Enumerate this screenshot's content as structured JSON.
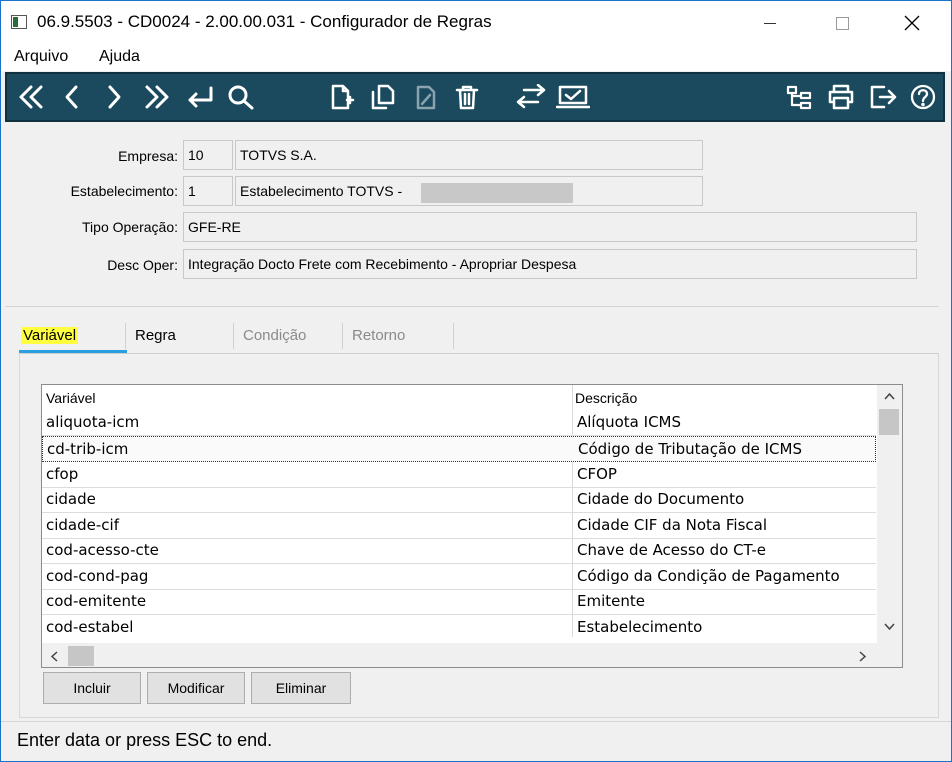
{
  "window": {
    "title": "06.9.5503 - CD0024 - 2.00.00.031 - Configurador de Regras",
    "minimize": "–",
    "maximize": "☐",
    "close": "✕"
  },
  "menu": {
    "items": [
      {
        "label": "Arquivo"
      },
      {
        "label": "Ajuda"
      }
    ]
  },
  "toolbar": {
    "buttons": [
      "first-icon",
      "previous-icon",
      "next-icon",
      "last-icon",
      "goto-icon",
      "search-icon",
      "new-icon",
      "copy-icon",
      "edit-icon",
      "delete-icon",
      "swap-icon",
      "confirm-icon",
      "tree-icon",
      "print-icon",
      "exit-icon",
      "help-icon"
    ]
  },
  "form": {
    "empresa_label": "Empresa:",
    "empresa_code": "10",
    "empresa_name": "TOTVS S.A.",
    "estab_label": "Estabelecimento:",
    "estab_code": "1",
    "estab_name": "Estabelecimento TOTVS -",
    "tipo_label": "Tipo Operação:",
    "tipo_value": "GFE-RE",
    "desc_label": "Desc Oper:",
    "desc_value": "Integração Docto Frete com Recebimento - Apropriar Despesa"
  },
  "tabs": [
    {
      "label": "Variável",
      "state": "active"
    },
    {
      "label": "Regra",
      "state": "enabled"
    },
    {
      "label": "Condição",
      "state": "disabled"
    },
    {
      "label": "Retorno",
      "state": "disabled"
    }
  ],
  "grid": {
    "columns": [
      "Variável",
      "Descrição"
    ],
    "rows": [
      {
        "var": "aliquota-icm",
        "desc": "Alíquota ICMS"
      },
      {
        "var": "cd-trib-icm",
        "desc": "Código de Tributação de ICMS",
        "selected": true
      },
      {
        "var": "cfop",
        "desc": "CFOP"
      },
      {
        "var": "cidade",
        "desc": "Cidade do Documento"
      },
      {
        "var": "cidade-cif",
        "desc": "Cidade CIF da Nota Fiscal"
      },
      {
        "var": "cod-acesso-cte",
        "desc": "Chave de Acesso do CT-e"
      },
      {
        "var": "cod-cond-pag",
        "desc": "Código da Condição de Pagamento"
      },
      {
        "var": "cod-emitente",
        "desc": "Emitente"
      },
      {
        "var": "cod-estabel",
        "desc": "Estabelecimento"
      }
    ]
  },
  "buttons": {
    "incluir": "Incluir",
    "modificar": "Modificar",
    "eliminar": "Eliminar"
  },
  "status": {
    "text": "Enter data or press ESC to end."
  },
  "colors": {
    "toolbar_bg": "#1b4a5e",
    "tab_highlight": "#ffff3f",
    "tab_underline": "#2a9fe0"
  }
}
